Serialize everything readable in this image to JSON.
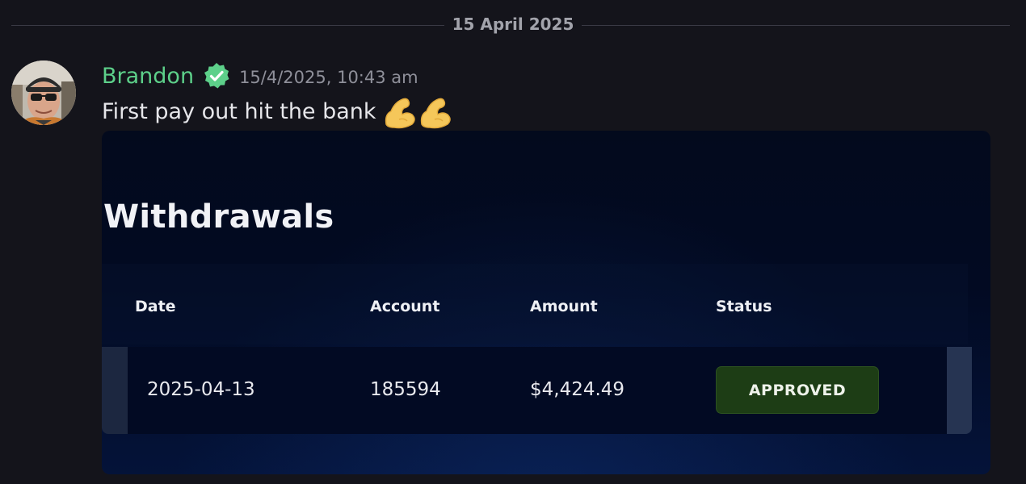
{
  "divider": {
    "date_label": "15 April 2025"
  },
  "message": {
    "author": "Brandon",
    "author_color": "#5dd08a",
    "verified_icon": "verified-check-icon",
    "timestamp": "15/4/2025, 10:43 am",
    "text": "First pay out hit the bank",
    "emoji": [
      "flexed-biceps",
      "flexed-biceps"
    ]
  },
  "attachment": {
    "title": "Withdrawals",
    "columns": [
      "Date",
      "Account",
      "Amount",
      "Status"
    ],
    "rows": [
      {
        "date": "2025-04-13",
        "account": "185594",
        "amount": "$4,424.49",
        "status": "APPROVED"
      }
    ],
    "status_color": "#1d3d15"
  }
}
